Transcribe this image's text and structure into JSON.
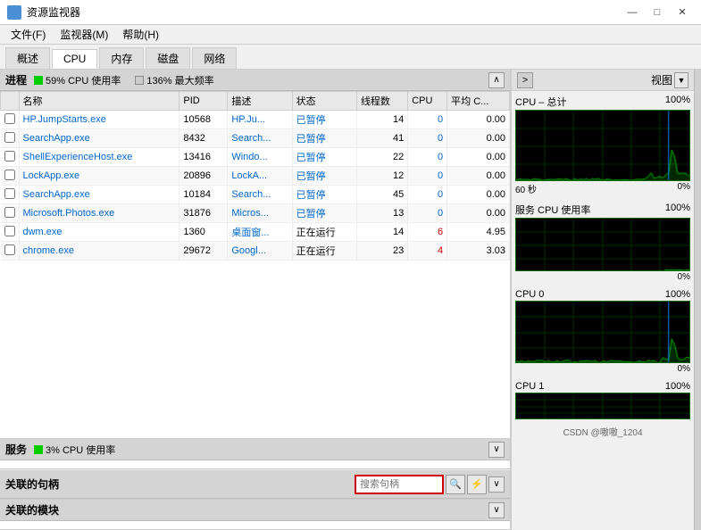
{
  "titleBar": {
    "icon": "monitor-icon",
    "title": "资源监视器",
    "minimize": "—",
    "maximize": "□",
    "close": "✕"
  },
  "menuBar": {
    "items": [
      "文件(F)",
      "监视器(M)",
      "帮助(H)"
    ]
  },
  "tabs": [
    {
      "label": "概述",
      "active": false
    },
    {
      "label": "CPU",
      "active": true
    },
    {
      "label": "内存",
      "active": false
    },
    {
      "label": "磁盘",
      "active": false
    },
    {
      "label": "网络",
      "active": false
    }
  ],
  "processSection": {
    "title": "进程",
    "cpuUsage": "59% CPU 使用率",
    "maxFreq": "136% 最大频率",
    "collapseBtn": "∧",
    "columns": [
      "",
      "名称",
      "PID",
      "描述",
      "状态",
      "线程数",
      "CPU",
      "平均 C..."
    ],
    "rows": [
      {
        "checked": false,
        "name": "HP.JumpStarts.exe",
        "pid": "10568",
        "desc": "HP.Ju...",
        "status": "已暂停",
        "threads": "14",
        "cpu": "0",
        "avgcpu": "0.00"
      },
      {
        "checked": false,
        "name": "SearchApp.exe",
        "pid": "8432",
        "desc": "Search...",
        "status": "已暂停",
        "threads": "41",
        "cpu": "0",
        "avgcpu": "0.00"
      },
      {
        "checked": false,
        "name": "ShellExperienceHost.exe",
        "pid": "13416",
        "desc": "Windo...",
        "status": "已暂停",
        "threads": "22",
        "cpu": "0",
        "avgcpu": "0.00"
      },
      {
        "checked": false,
        "name": "LockApp.exe",
        "pid": "20896",
        "desc": "LockA...",
        "status": "已暂停",
        "threads": "12",
        "cpu": "0",
        "avgcpu": "0.00"
      },
      {
        "checked": false,
        "name": "SearchApp.exe",
        "pid": "10184",
        "desc": "Search...",
        "status": "已暂停",
        "threads": "45",
        "cpu": "0",
        "avgcpu": "0.00"
      },
      {
        "checked": false,
        "name": "Microsoft.Photos.exe",
        "pid": "31876",
        "desc": "Micros...",
        "status": "已暂停",
        "threads": "13",
        "cpu": "0",
        "avgcpu": "0.00"
      },
      {
        "checked": false,
        "name": "dwm.exe",
        "pid": "1360",
        "desc": "桌面窗...",
        "status": "正在运行",
        "threads": "14",
        "cpu": "6",
        "avgcpu": "4.95"
      },
      {
        "checked": false,
        "name": "chrome.exe",
        "pid": "29672",
        "desc": "Googl...",
        "status": "正在运行",
        "threads": "23",
        "cpu": "4",
        "avgcpu": "3.03"
      }
    ]
  },
  "servicesSection": {
    "title": "服务",
    "cpuUsage": "3% CPU 使用率",
    "collapseBtn": "∨"
  },
  "handlesSection": {
    "title": "关联的句柄",
    "searchPlaceholder": "搜索句柄",
    "collapseBtn": "∨"
  },
  "modulesSection": {
    "title": "关联的模块",
    "collapseBtn": "∨"
  },
  "rightPanel": {
    "expandBtn": ">",
    "viewLabel": "视图",
    "viewDropdownArrow": "▼",
    "cpuTotalLabel": "CPU – 总计",
    "cpuTotalPercent": "100%",
    "cpuTotalZeroPercent": "0%",
    "timeLabel": "60 秒",
    "serviceCpuLabel": "服务 CPU 使用率",
    "serviceCpuPercent": "100%",
    "serviceCpuZeroPercent": "0%",
    "cpu0Label": "CPU 0",
    "cpu0Percent": "100%",
    "cpu0ZeroPercent": "0%",
    "cpu1Label": "CPU 1",
    "cpu1Percent": "100%",
    "watermark": "CSDN @嗷嗷_1204"
  },
  "colors": {
    "accent": "#0066cc",
    "green": "#00cc00",
    "graphGreen": "#00ff00",
    "graphBg": "#000000",
    "graphGrid": "#003300",
    "graphBlue": "#0066ff",
    "red": "#cc0000"
  }
}
